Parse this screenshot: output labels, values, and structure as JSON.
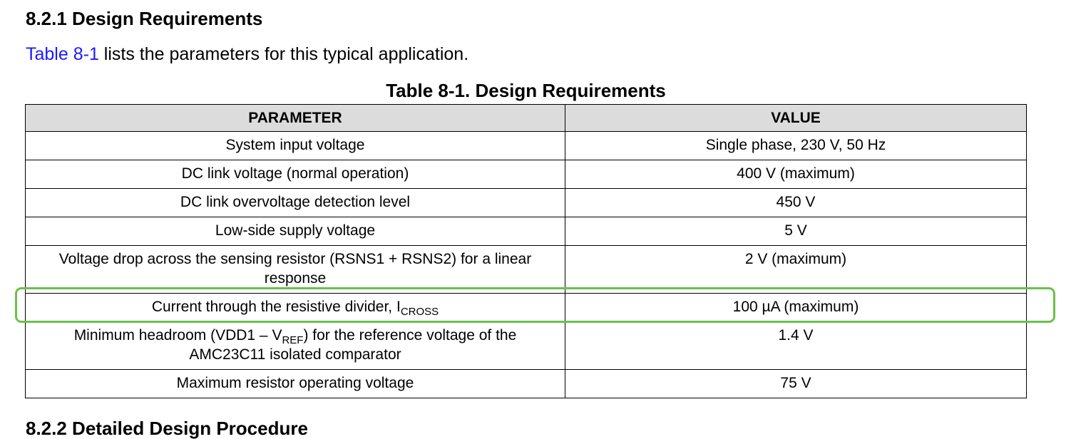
{
  "headings": {
    "design_requirements": "8.2.1 Design Requirements",
    "detailed_design": "8.2.2 Detailed Design Procedure"
  },
  "intro": {
    "link_text": "Table 8-1",
    "rest": " lists the parameters for this typical application."
  },
  "table": {
    "caption": "Table 8-1. Design Requirements",
    "headers": [
      "PARAMETER",
      "VALUE"
    ],
    "rows": [
      {
        "parameter": "System input voltage",
        "value": "Single phase, 230 V, 50 Hz"
      },
      {
        "parameter": "DC link voltage (normal operation)",
        "value": "400 V (maximum)"
      },
      {
        "parameter": "DC link overvoltage detection level",
        "value": "450 V"
      },
      {
        "parameter": "Low-side supply voltage",
        "value": "5 V"
      },
      {
        "parameter": "Voltage drop across the sensing resistor (RSNS1 + RSNS2) for a linear response",
        "value": "2 V (maximum)"
      },
      {
        "parameter_pre": "Current through the resistive divider, I",
        "parameter_sub": "CROSS",
        "value": "100 µA (maximum)"
      },
      {
        "parameter_pre": "Minimum headroom (VDD1 – V",
        "parameter_sub": "REF",
        "parameter_post": ") for the reference voltage of the AMC23C11 isolated comparator",
        "value": "1.4 V"
      },
      {
        "parameter": "Maximum resistor operating voltage",
        "value": "75 V"
      }
    ]
  },
  "colors": {
    "link": "#1a1aff",
    "header_bg": "#dcdcdc",
    "highlight_border": "#6cc04a"
  }
}
